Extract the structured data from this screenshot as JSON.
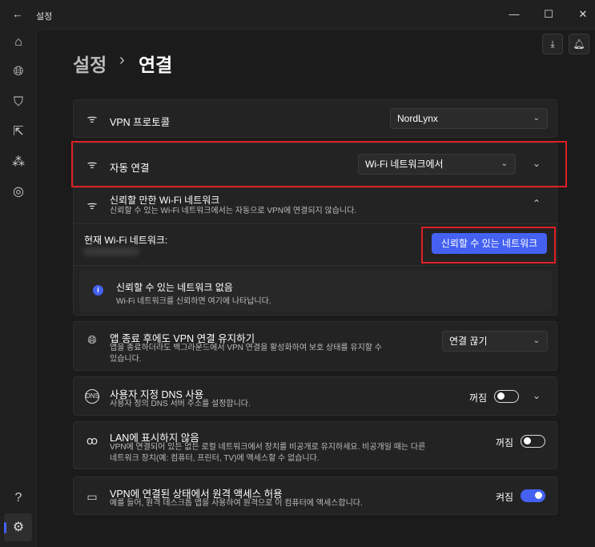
{
  "window": {
    "title": "설정",
    "back_icon": "arrow-left",
    "min": "—",
    "max": "☐",
    "close": "✕"
  },
  "header": {
    "breadcrumb_root": "설정",
    "separator": "›",
    "page_title": "연결"
  },
  "colors": {
    "accent": "#4461f2",
    "highlight": "#e01f26"
  },
  "rows": {
    "vpn_protocol": {
      "title": "VPN 프로토콜",
      "value": "NordLynx"
    },
    "auto_connect": {
      "title": "자동 연결",
      "value": "Wi-Fi 네트워크에서"
    },
    "trusted_wifi": {
      "title": "신뢰할 만한 Wi-Fi 네트워크",
      "desc": "신뢰할 수 있는 Wi-Fi 네트워크에서는 자동으로 VPN에 연결되지 않습니다.",
      "current_label": "현재 Wi-Fi 네트워크:",
      "trust_button": "신뢰할 수 있는 네트워크",
      "empty_title": "신뢰할 수 있는 네트워크 없음",
      "empty_desc": "Wi-Fi 네트워크를 신뢰하면 여기에 나타납니다."
    },
    "keep_vpn": {
      "title": "앱 종료 후에도 VPN 연결 유지하기",
      "desc": "앱을 종료하더라도 백그라운드에서 VPN 연결을 활성화하여 보호 상태를 유지할 수 있습니다.",
      "value": "연결 끊기"
    },
    "custom_dns": {
      "title": "사용자 지정 DNS 사용",
      "desc": "사용자 정의 DNS 서버 주소를 설정합니다.",
      "state": "꺼짐",
      "on": false
    },
    "lan_invisible": {
      "title": "LAN에 표시하지 않음",
      "desc": "VPN에 연결되어 있든 없든 로컬 네트워크에서 장치를 비공개로 유지하세요. 비공개일 때는 다른 네트워크 장치(예: 컴퓨터, 프린터, TV)에 액세스할 수 없습니다.",
      "state": "꺼짐",
      "on": false
    },
    "remote_access": {
      "title": "VPN에 연결된 상태에서 원격 액세스 허용",
      "desc": "예를 들어, 원격 데스크톱 앱을 사용하여 원격으로 이 컴퓨터에 액세스합니다.",
      "state": "켜짐",
      "on": true
    }
  }
}
